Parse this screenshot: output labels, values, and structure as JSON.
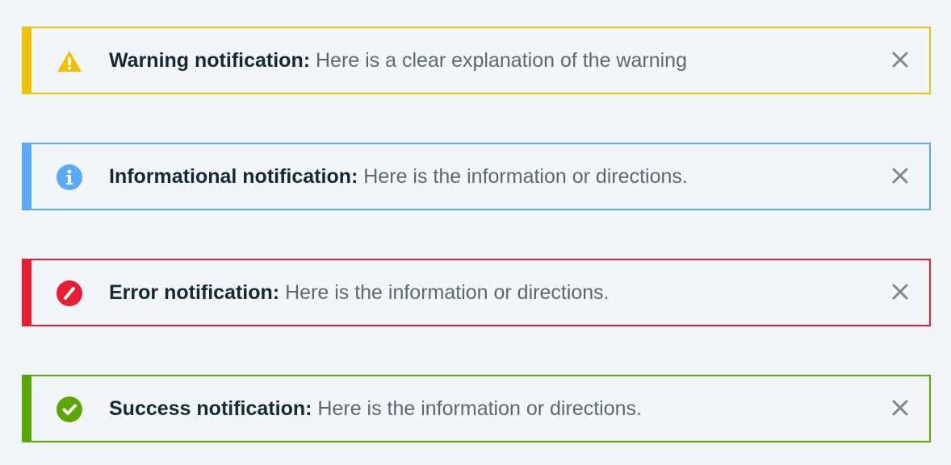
{
  "notifications": [
    {
      "kind": "warning",
      "icon": "warning-icon",
      "accent_color": "#efc100",
      "title": "Warning notification:",
      "message": "Here is a clear explanation of the warning",
      "close_icon": "close-icon"
    },
    {
      "kind": "info",
      "icon": "info-icon",
      "accent_color": "#5aaafa",
      "title": "Informational notification:",
      "message": "Here is the information or directions.",
      "close_icon": "close-icon"
    },
    {
      "kind": "error",
      "icon": "error-icon",
      "accent_color": "#e71d32",
      "title": "Error notification:",
      "message": "Here is the information or directions.",
      "close_icon": "close-icon"
    },
    {
      "kind": "success",
      "icon": "success-icon",
      "accent_color": "#5aa700",
      "title": "Success notification:",
      "message": "Here is the information or directions.",
      "close_icon": "close-icon"
    }
  ]
}
